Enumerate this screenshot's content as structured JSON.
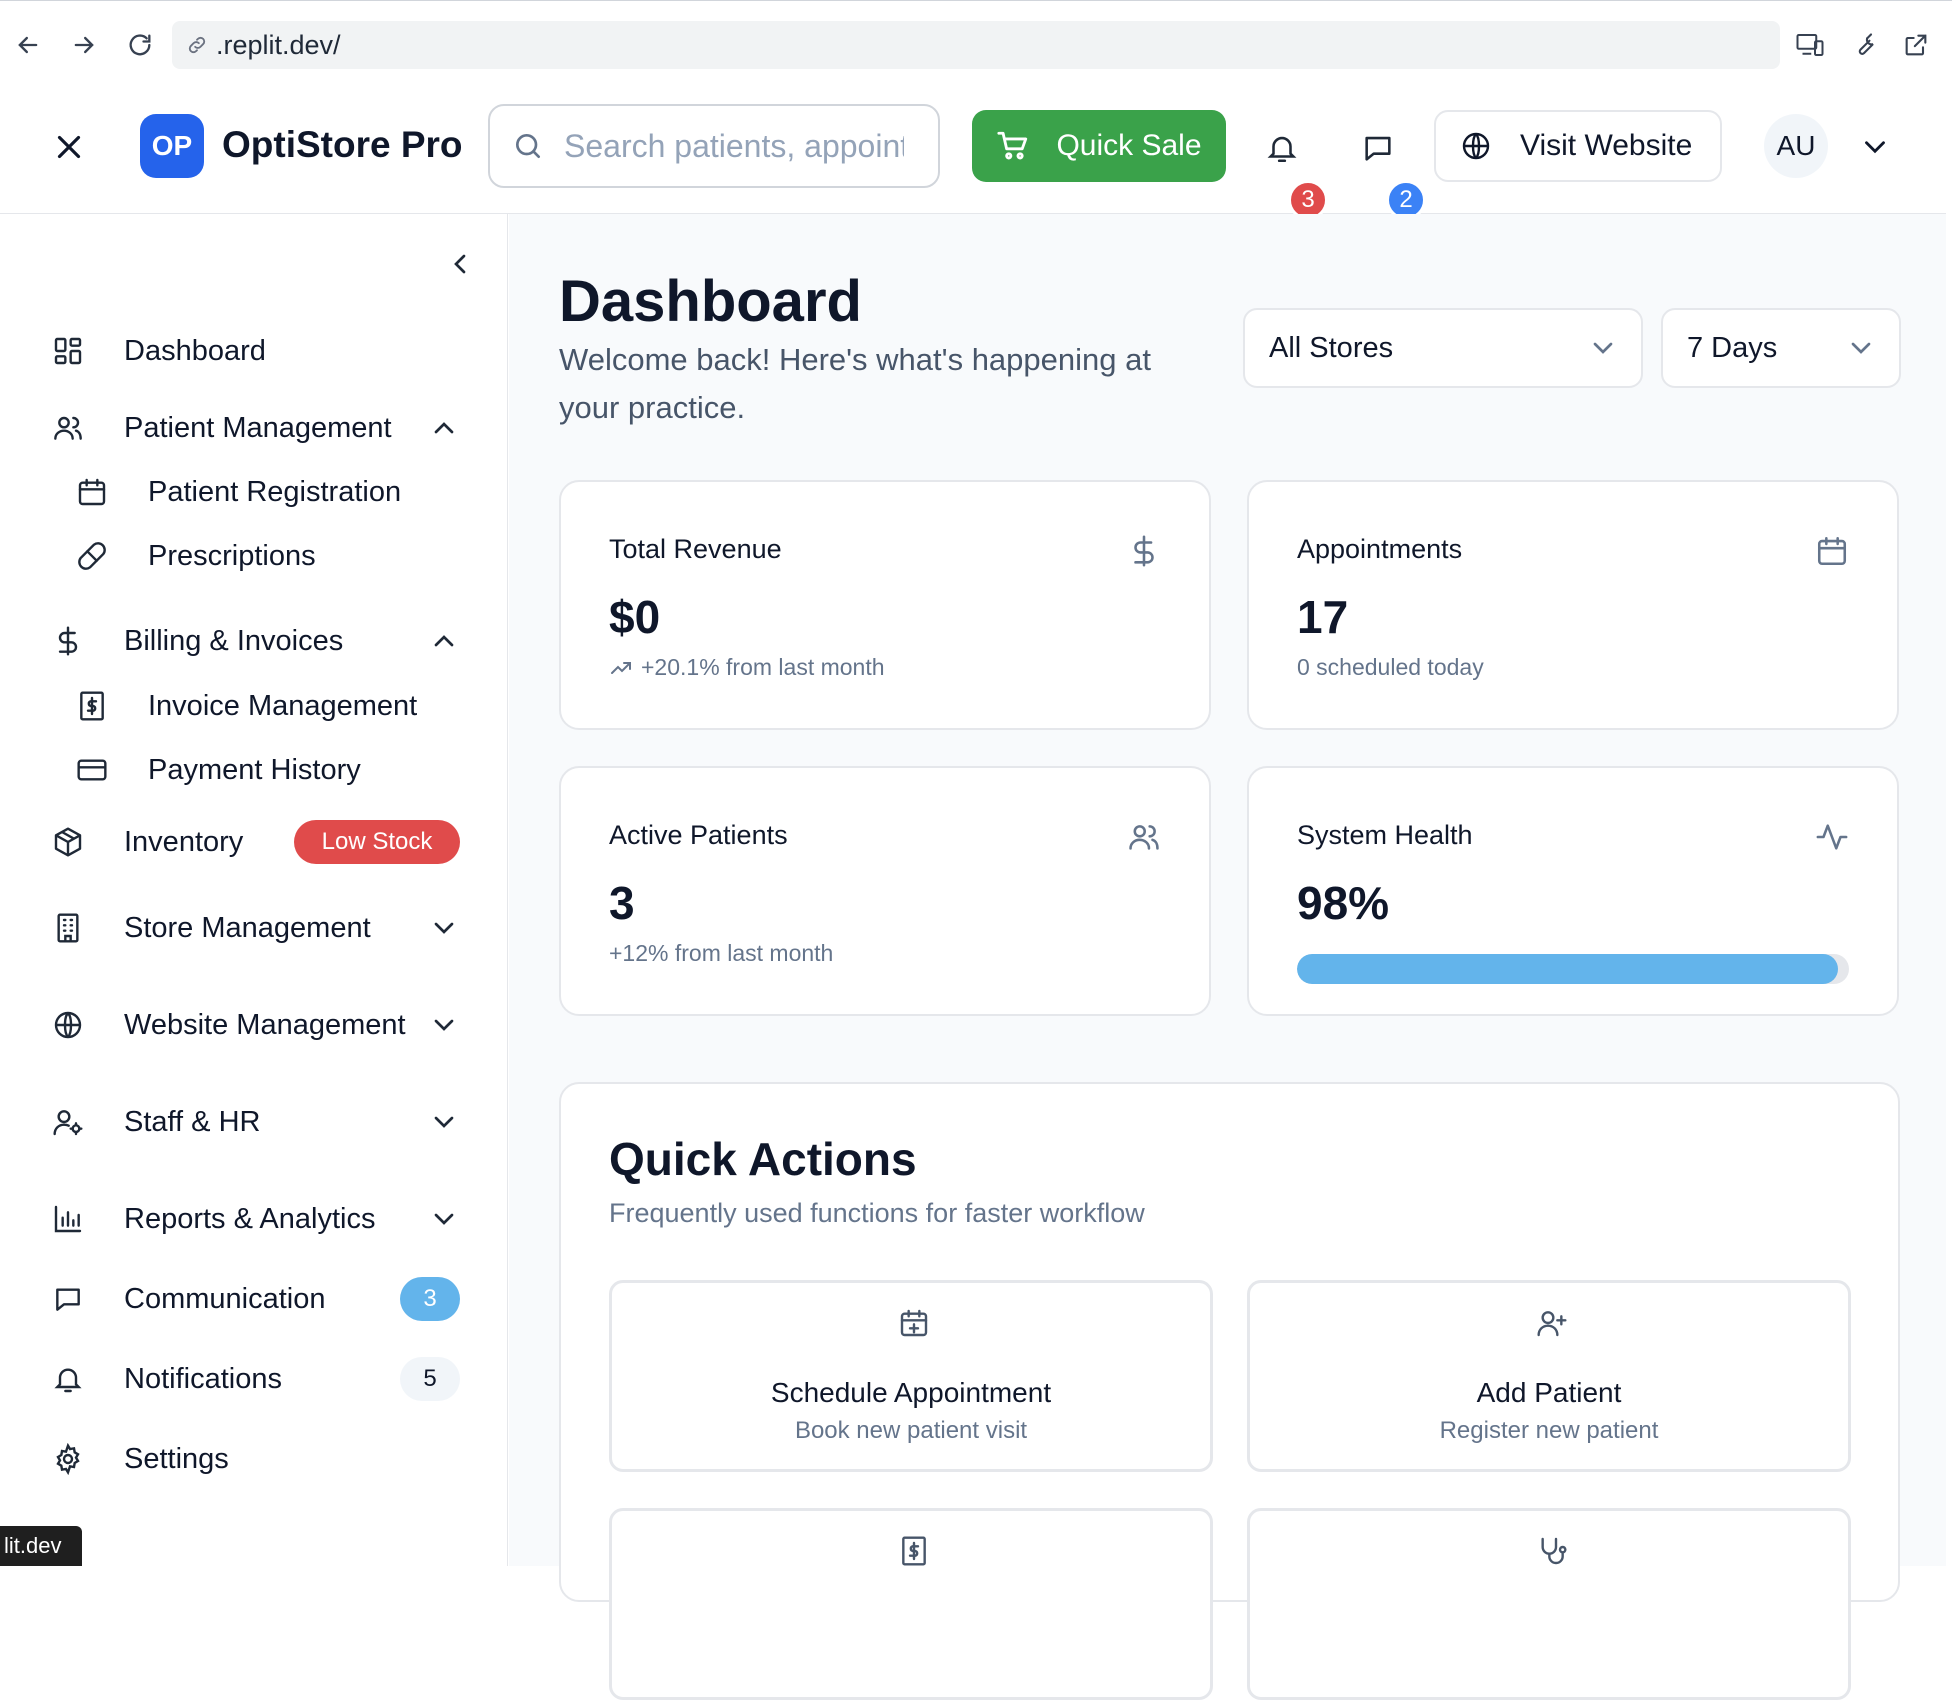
{
  "browser": {
    "url": ".replit.dev/",
    "tooltip": "lit.dev"
  },
  "header": {
    "logo_initials": "OP",
    "app_name": "OptiStore Pro",
    "search_placeholder": "Search patients, appointments...",
    "quick_sale_label": "Quick Sale",
    "notifications_count": "3",
    "messages_count": "2",
    "visit_website_label": "Visit Website",
    "avatar_initials": "AU"
  },
  "sidebar": {
    "items": [
      {
        "label": "Dashboard",
        "icon": "layout-dashboard-icon"
      },
      {
        "label": "Patient Management",
        "icon": "users-icon",
        "expanded": true
      },
      {
        "label": "Patient Registration",
        "icon": "calendar-icon"
      },
      {
        "label": "Prescriptions",
        "icon": "pill-icon"
      },
      {
        "label": "Billing & Invoices",
        "icon": "dollar-icon",
        "expanded": true
      },
      {
        "label": "Invoice Management",
        "icon": "receipt-icon"
      },
      {
        "label": "Payment History",
        "icon": "credit-card-icon"
      },
      {
        "label": "Inventory",
        "icon": "package-icon",
        "badge": "Low Stock"
      },
      {
        "label": "Store Management",
        "icon": "building-icon"
      },
      {
        "label": "Website Management",
        "icon": "globe-icon"
      },
      {
        "label": "Staff & HR",
        "icon": "user-cog-icon"
      },
      {
        "label": "Reports & Analytics",
        "icon": "bar-chart-icon"
      },
      {
        "label": "Communication",
        "icon": "message-square-icon",
        "badge": "3"
      },
      {
        "label": "Notifications",
        "icon": "bell-icon",
        "badge": "5"
      },
      {
        "label": "Settings",
        "icon": "settings-icon"
      }
    ]
  },
  "main": {
    "title": "Dashboard",
    "subtitle": "Welcome back! Here's what's happening at your practice.",
    "store_filter": "All Stores",
    "period_filter": "7 Days",
    "stats": [
      {
        "title": "Total Revenue",
        "value": "$0",
        "sub": "+20.1% from last month",
        "icon": "dollar-icon"
      },
      {
        "title": "Appointments",
        "value": "17",
        "sub": "0 scheduled today",
        "icon": "calendar-icon"
      },
      {
        "title": "Active Patients",
        "value": "3",
        "sub": "+12% from last month",
        "icon": "users-icon"
      },
      {
        "title": "System Health",
        "value": "98%",
        "progress": 98,
        "icon": "activity-icon"
      }
    ],
    "quick_actions": {
      "title": "Quick Actions",
      "subtitle": "Frequently used functions for faster workflow",
      "items": [
        {
          "label": "Schedule Appointment",
          "desc": "Book new patient visit",
          "icon": "calendar-plus-icon"
        },
        {
          "label": "Add Patient",
          "desc": "Register new patient",
          "icon": "user-plus-icon"
        },
        {
          "label": "",
          "desc": "",
          "icon": "receipt-icon"
        },
        {
          "label": "",
          "desc": "",
          "icon": "stethoscope-icon"
        }
      ]
    }
  },
  "colors": {
    "brand": "#2563eb",
    "quick_sale": "#3aa24a",
    "danger_badge": "#e04b4b",
    "info_badge": "#63b4eb",
    "progress": "#63b4eb"
  }
}
